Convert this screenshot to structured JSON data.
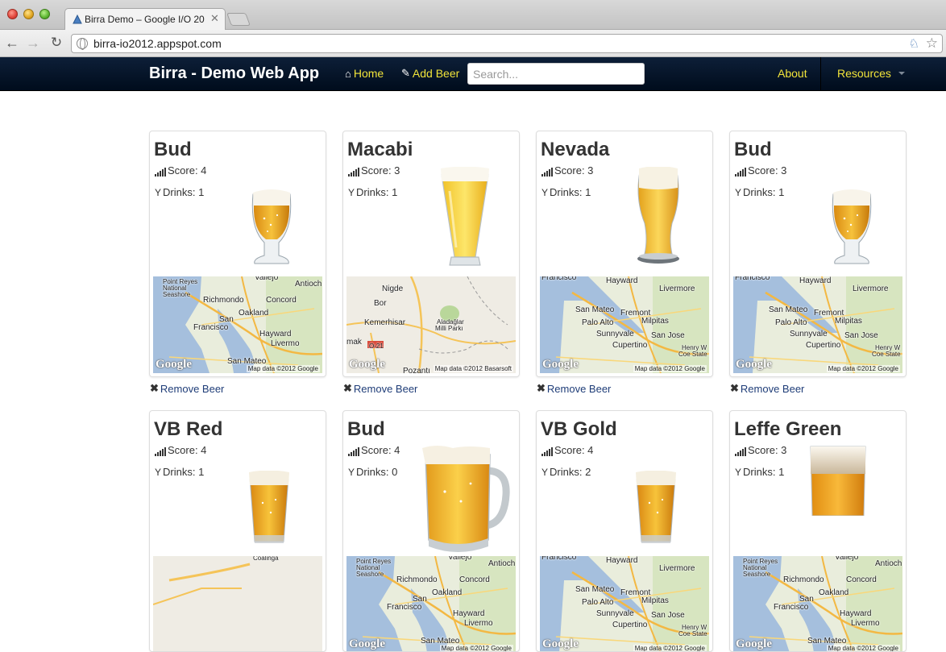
{
  "browser": {
    "tab_title": "Birra Demo – Google I/O 20",
    "url": "birra-io2012.appspot.com"
  },
  "navbar": {
    "brand": "Birra - Demo Web App",
    "home": "Home",
    "add_beer": "Add Beer",
    "search_placeholder": "Search...",
    "about": "About",
    "resources": "Resources"
  },
  "labels": {
    "score": "Score: ",
    "drinks": "Drinks: ",
    "remove": "Remove Beer",
    "map_credit_google": "Map data ©2012 Google",
    "map_credit_basarsoft": "Map data ©2012 Basarsoft",
    "google_logo": "Google"
  },
  "beers": [
    {
      "name": "Bud",
      "score": "4",
      "drinks": "1",
      "glass": "tulip",
      "map": "bayarea"
    },
    {
      "name": "Macabi",
      "score": "3",
      "drinks": "1",
      "glass": "pilsner",
      "map": "turkey"
    },
    {
      "name": "Nevada",
      "score": "3",
      "drinks": "1",
      "glass": "weizen",
      "map": "southbay"
    },
    {
      "name": "Bud",
      "score": "3",
      "drinks": "1",
      "glass": "tulip",
      "map": "southbay"
    },
    {
      "name": "VB Red",
      "score": "4",
      "drinks": "1",
      "glass": "pint",
      "map": "coalinga"
    },
    {
      "name": "Bud",
      "score": "4",
      "drinks": "0",
      "glass": "pitcher",
      "map": "bayarea"
    },
    {
      "name": "VB Gold",
      "score": "4",
      "drinks": "2",
      "glass": "pint",
      "map": "southbay"
    },
    {
      "name": "Leffe Green",
      "score": "3",
      "drinks": "1",
      "glass": "stange",
      "map": "bayarea"
    }
  ],
  "map_places": {
    "bayarea": [
      "Point Reyes",
      "National",
      "Seashore",
      "Richmondo",
      "Concord",
      "Oakland",
      "San",
      "Francisco",
      "Hayward",
      "Livermo",
      "San Mateo",
      "Vallejo",
      "Antioch"
    ],
    "southbay": [
      "Francisco",
      "Hayward",
      "Livermore",
      "San Mateo",
      "Fremont",
      "Palo Alto",
      "Milpitas",
      "Sunnyvale",
      "San Jose",
      "Cupertino",
      "Henry W",
      "Coe State P"
    ],
    "turkey": [
      "Nigde",
      "Bor",
      "Kemerhisar",
      "Aladağlar",
      "Milli Parkı",
      "Pozantı",
      "mak",
      "O-21"
    ],
    "coalinga": [
      "Coalinga"
    ]
  },
  "colors": {
    "navbar_bg": "#0b1a30",
    "nav_link": "#f2e43a",
    "remove_link": "#1f3d78"
  }
}
